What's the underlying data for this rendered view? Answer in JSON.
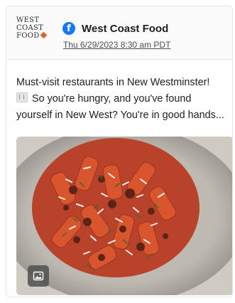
{
  "post": {
    "logo_lines": [
      "WEST",
      "COAST",
      "FOOD"
    ],
    "logo_accent_color": "#e2642a",
    "platform_icon": "facebook-icon",
    "platform_color": "#1877f2",
    "page_name": "West Coast Food",
    "timestamp": "Thu 6/29/2023 8:30 am PDT",
    "text_lines": [
      "Must-visit restaurants in New Westminster!",
      "So you're hungry, and you've found",
      "yourself in New West? You're in good hands..."
    ],
    "text_emoji_icon": "fork-and-knife-icon",
    "image_badge_icon": "image-icon"
  }
}
